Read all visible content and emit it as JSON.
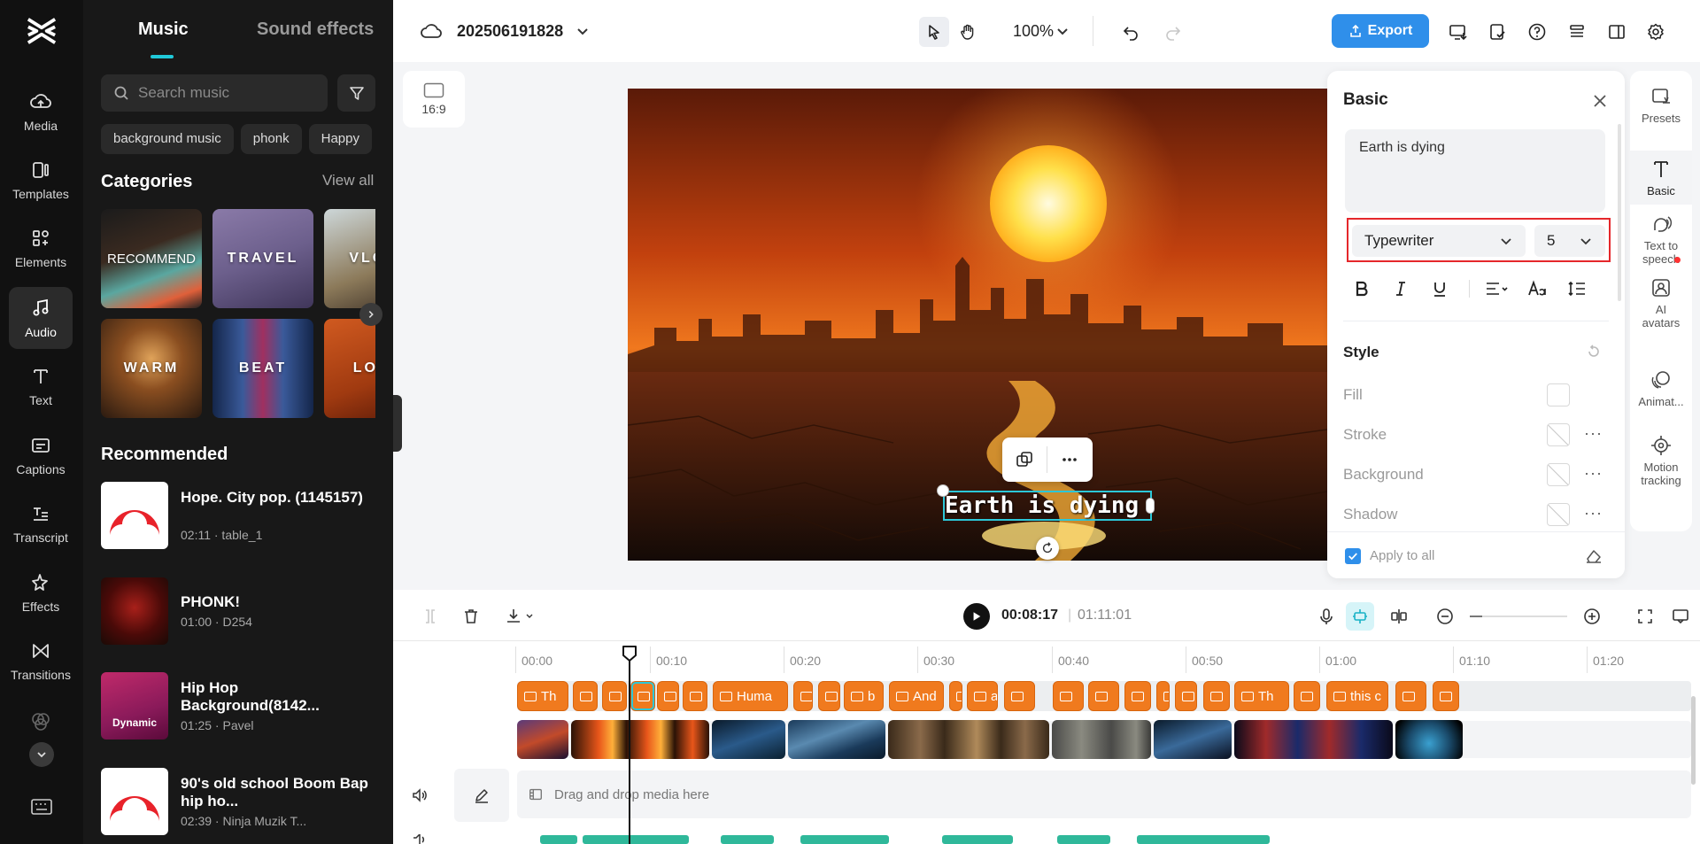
{
  "rail": {
    "items": [
      {
        "label": "Media",
        "icon": "cloud-upload-icon"
      },
      {
        "label": "Templates",
        "icon": "templates-icon"
      },
      {
        "label": "Elements",
        "icon": "elements-icon"
      },
      {
        "label": "Audio",
        "icon": "music-note-icon"
      },
      {
        "label": "Text",
        "icon": "text-icon"
      },
      {
        "label": "Captions",
        "icon": "captions-icon"
      },
      {
        "label": "Transcript",
        "icon": "transcript-icon"
      },
      {
        "label": "Effects",
        "icon": "effects-icon"
      },
      {
        "label": "Transitions",
        "icon": "transitions-icon"
      }
    ]
  },
  "panel": {
    "tabs": [
      "Music",
      "Sound effects"
    ],
    "search_placeholder": "Search music",
    "chips": [
      "background music",
      "phonk",
      "Happy"
    ],
    "categories_title": "Categories",
    "view_all": "View all",
    "categories": [
      "RECOMMEND",
      "TRAVEL",
      "VLOG",
      "WARM",
      "BEAT",
      "LOFI"
    ],
    "recommended_title": "Recommended",
    "recommended": [
      {
        "title": "Hope. City pop. (1145157)",
        "meta": "02:11 · table_1"
      },
      {
        "title": "PHONK!",
        "meta": "01:00 · D254"
      },
      {
        "title": "Hip Hop Background(8142...",
        "meta": "01:25 · Pavel",
        "thumb_text": "Dynamic"
      },
      {
        "title": "90's old school Boom Bap hip ho...",
        "meta": "02:39 · Ninja Muzik T..."
      }
    ]
  },
  "topbar": {
    "project_name": "202506191828",
    "zoom": "100%",
    "export": "Export"
  },
  "canvas": {
    "ratio": "16:9",
    "overlay_text": "Earth is dying"
  },
  "props": {
    "title": "Basic",
    "text_value": "Earth is dying",
    "animation": "Typewriter",
    "speed": "5",
    "style_title": "Style",
    "style_rows": [
      "Fill",
      "Stroke",
      "Background",
      "Shadow"
    ],
    "apply_all": "Apply to all"
  },
  "right_rail": {
    "items": [
      "Presets",
      "Basic",
      "Text to speech",
      "AI avatars",
      "Animat...",
      "Motion tracking"
    ]
  },
  "timeline": {
    "current_time": "00:08:17",
    "total_time": "01:11:01",
    "ruler": [
      "00:00",
      "00:10",
      "00:20",
      "00:30",
      "00:40",
      "00:50",
      "01:00",
      "01:10",
      "01:20"
    ],
    "text_clip_labels": [
      "Th",
      "",
      "",
      "",
      "",
      "",
      "Huma",
      "",
      "",
      "b",
      "And",
      "",
      "a",
      "",
      "",
      "",
      "",
      "",
      "",
      "",
      "Th",
      "",
      "this c",
      "",
      ""
    ],
    "drop_hint": "Drag and drop media here"
  }
}
